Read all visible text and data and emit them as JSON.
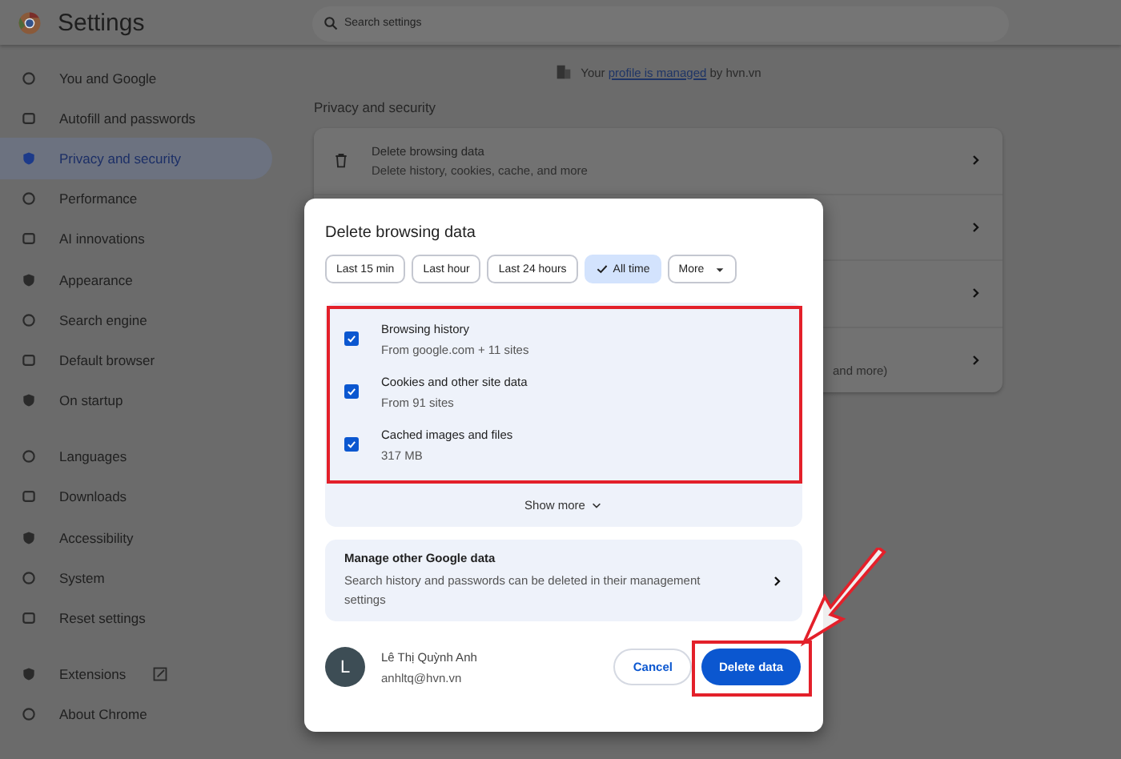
{
  "app": {
    "title": "Settings"
  },
  "search": {
    "placeholder": "Search settings"
  },
  "sidebar": {
    "sections": [
      {
        "items": [
          {
            "label": "You and Google",
            "selected": false
          },
          {
            "label": "Autofill and passwords",
            "selected": false
          },
          {
            "label": "Privacy and security",
            "selected": true
          },
          {
            "label": "Performance",
            "selected": false
          },
          {
            "label": "AI innovations",
            "selected": false
          },
          {
            "label": "Appearance",
            "selected": false
          },
          {
            "label": "Search engine",
            "selected": false
          },
          {
            "label": "Default browser",
            "selected": false
          },
          {
            "label": "On startup",
            "selected": false
          }
        ]
      },
      {
        "items": [
          {
            "label": "Languages",
            "selected": false
          },
          {
            "label": "Downloads",
            "selected": false
          },
          {
            "label": "Accessibility",
            "selected": false
          },
          {
            "label": "System",
            "selected": false
          },
          {
            "label": "Reset settings",
            "selected": false
          }
        ]
      },
      {
        "items": [
          {
            "label": "Extensions",
            "selected": false,
            "external": true
          },
          {
            "label": "About Chrome",
            "selected": false
          }
        ]
      }
    ]
  },
  "banner": {
    "prefix": "Your",
    "link": "profile is managed",
    "suffix": "by hvn.vn"
  },
  "section_title": "Privacy and security",
  "card": {
    "rows": [
      {
        "kind": "full",
        "title": "Delete browsing data",
        "subtitle": "Delete history, cookies, cache, and more"
      },
      {
        "kind": "covered"
      },
      {
        "kind": "covered"
      },
      {
        "kind": "covered",
        "subtitle": "and more)"
      }
    ]
  },
  "dialog": {
    "title": "Delete browsing data",
    "time_ranges": [
      {
        "label": "Last 15 min",
        "selected": false,
        "kind": "chip"
      },
      {
        "label": "Last hour",
        "selected": false,
        "kind": "chip"
      },
      {
        "label": "Last 24 hours",
        "selected": false,
        "kind": "chip"
      },
      {
        "label": "All time",
        "selected": true,
        "kind": "chip"
      },
      {
        "label": "More",
        "selected": false,
        "kind": "dropdown"
      }
    ],
    "items": [
      {
        "label": "Browsing history",
        "detail": "From google.com + 11 sites",
        "checked": true
      },
      {
        "label": "Cookies and other site data",
        "detail": "From 91 sites",
        "checked": true
      },
      {
        "label": "Cached images and files",
        "detail": "317 MB",
        "checked": true
      }
    ],
    "show_more": "Show more",
    "manage": {
      "title": "Manage other Google data",
      "text": "Search history and passwords can be deleted in their management settings"
    },
    "account": {
      "initial": "L",
      "name": "Lê Thị Quỳnh Anh",
      "email": "anhltq@hvn.vn"
    },
    "cancel": "Cancel",
    "confirm": "Delete data"
  }
}
